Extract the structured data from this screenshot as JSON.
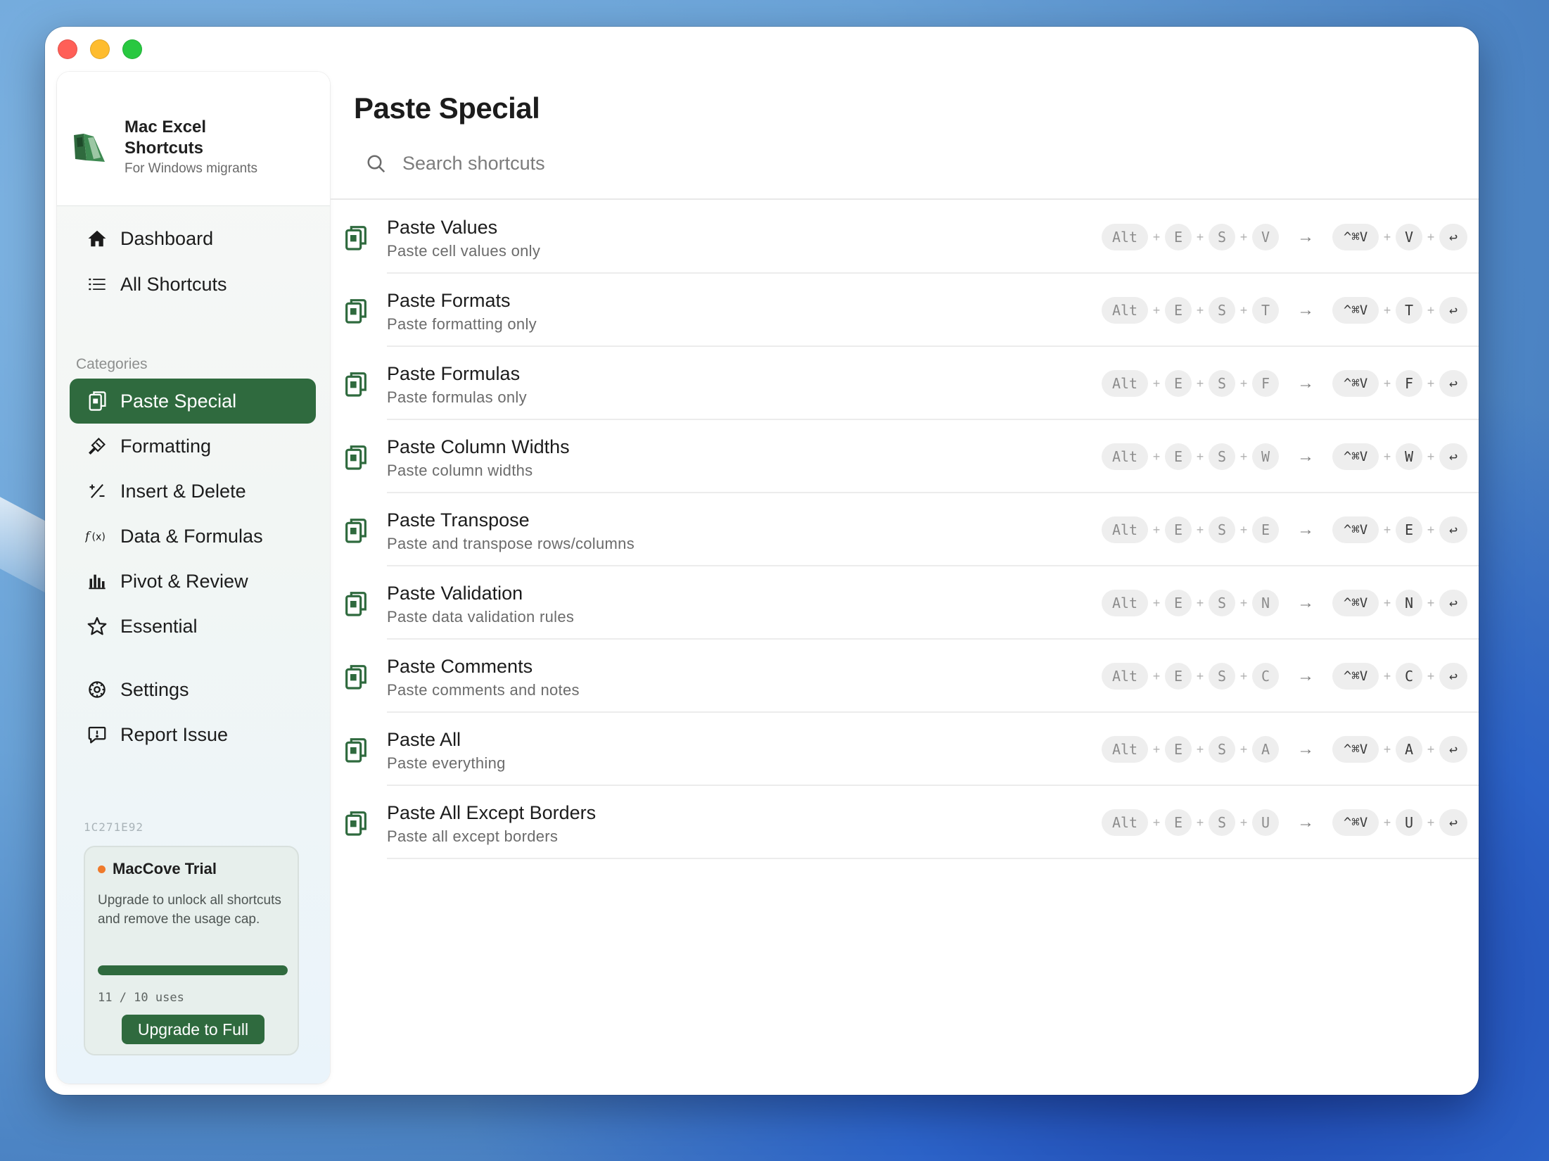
{
  "brand": {
    "title": "Mac Excel Shortcuts",
    "subtitle": "For Windows migrants"
  },
  "nav": {
    "primary": [
      {
        "label": "Dashboard",
        "icon": "house-icon"
      },
      {
        "label": "All Shortcuts",
        "icon": "list-icon"
      }
    ],
    "categories_heading": "Categories",
    "categories": [
      {
        "label": "Paste Special",
        "icon": "clipboard-icon",
        "active": true
      },
      {
        "label": "Formatting",
        "icon": "paintbrush-icon"
      },
      {
        "label": "Insert & Delete",
        "icon": "plus-minus-icon"
      },
      {
        "label": "Data & Formulas",
        "icon": "function-icon"
      },
      {
        "label": "Pivot & Review",
        "icon": "bar-chart-icon"
      },
      {
        "label": "Essential",
        "icon": "star-icon"
      }
    ],
    "footer": [
      {
        "label": "Settings",
        "icon": "gear-icon"
      },
      {
        "label": "Report Issue",
        "icon": "speech-bubble-icon"
      }
    ]
  },
  "machine_id": "1C271E92",
  "trial": {
    "title": "MacCove Trial",
    "description": "Upgrade to unlock all shortcuts and remove the usage cap.",
    "usage_text": "11 / 10 uses",
    "usage_fraction": 1.0,
    "button_label": "Upgrade to Full"
  },
  "main": {
    "title": "Paste Special",
    "search_placeholder": "Search shortcuts"
  },
  "shortcuts": [
    {
      "title": "Paste Values",
      "subtitle": "Paste cell values only",
      "win_keys": [
        "Alt",
        "E",
        "S",
        "V"
      ],
      "mac_keys": [
        "^⌘V",
        "V",
        "↩"
      ]
    },
    {
      "title": "Paste Formats",
      "subtitle": "Paste formatting only",
      "win_keys": [
        "Alt",
        "E",
        "S",
        "T"
      ],
      "mac_keys": [
        "^⌘V",
        "T",
        "↩"
      ]
    },
    {
      "title": "Paste Formulas",
      "subtitle": "Paste formulas only",
      "win_keys": [
        "Alt",
        "E",
        "S",
        "F"
      ],
      "mac_keys": [
        "^⌘V",
        "F",
        "↩"
      ]
    },
    {
      "title": "Paste Column Widths",
      "subtitle": "Paste column widths",
      "win_keys": [
        "Alt",
        "E",
        "S",
        "W"
      ],
      "mac_keys": [
        "^⌘V",
        "W",
        "↩"
      ]
    },
    {
      "title": "Paste Transpose",
      "subtitle": "Paste and transpose rows/columns",
      "win_keys": [
        "Alt",
        "E",
        "S",
        "E"
      ],
      "mac_keys": [
        "^⌘V",
        "E",
        "↩"
      ]
    },
    {
      "title": "Paste Validation",
      "subtitle": "Paste data validation rules",
      "win_keys": [
        "Alt",
        "E",
        "S",
        "N"
      ],
      "mac_keys": [
        "^⌘V",
        "N",
        "↩"
      ]
    },
    {
      "title": "Paste Comments",
      "subtitle": "Paste comments and notes",
      "win_keys": [
        "Alt",
        "E",
        "S",
        "C"
      ],
      "mac_keys": [
        "^⌘V",
        "C",
        "↩"
      ]
    },
    {
      "title": "Paste All",
      "subtitle": "Paste everything",
      "win_keys": [
        "Alt",
        "E",
        "S",
        "A"
      ],
      "mac_keys": [
        "^⌘V",
        "A",
        "↩"
      ]
    },
    {
      "title": "Paste All Except Borders",
      "subtitle": "Paste all except borders",
      "win_keys": [
        "Alt",
        "E",
        "S",
        "U"
      ],
      "mac_keys": [
        "^⌘V",
        "U",
        "↩"
      ]
    }
  ],
  "colors": {
    "accent": "#2f6a3e",
    "trial_dot": "#ef7a2b"
  }
}
